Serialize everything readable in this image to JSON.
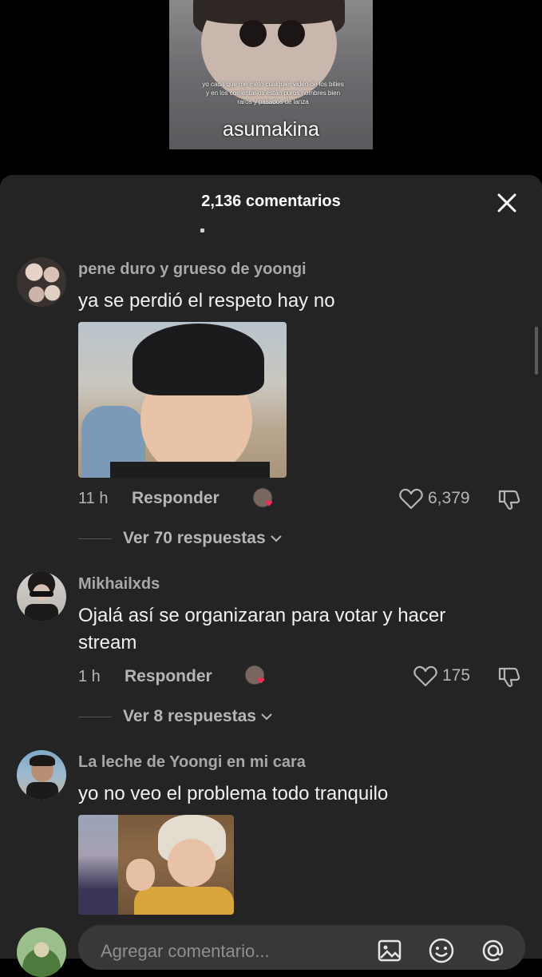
{
  "video": {
    "caption": "yo cada que me meto cualquier video de los bities y en los comentarios están puros nombres bien raros y pasados de lanza",
    "big_text": "asumakina"
  },
  "sheet": {
    "title": "2,136 comentarios"
  },
  "comments": [
    {
      "username": "pene duro y grueso de yoongi",
      "text": "ya se perdió el respeto hay no",
      "time": "11 h",
      "reply_label": "Responder",
      "likes": "6,379",
      "view_replies": "Ver 70 respuestas"
    },
    {
      "username": "Mikhailxds",
      "text": "Ojalá así se organizaran para votar y hacer stream",
      "time": "1 h",
      "reply_label": "Responder",
      "likes": "175",
      "view_replies": "Ver 8 respuestas"
    },
    {
      "username": "La leche de Yoongi en mi cara",
      "text": "yo no veo el problema todo tranquilo"
    }
  ],
  "input": {
    "placeholder": "Agregar comentario..."
  },
  "colors": {
    "sheet_bg": "#242424",
    "text_muted": "#a8a8a8",
    "heart_red": "#fe2c55"
  },
  "icons": [
    "close-icon",
    "heart-outline-icon",
    "dislike-icon",
    "chevron-down-icon",
    "image-icon",
    "emoji-icon",
    "mention-icon"
  ]
}
